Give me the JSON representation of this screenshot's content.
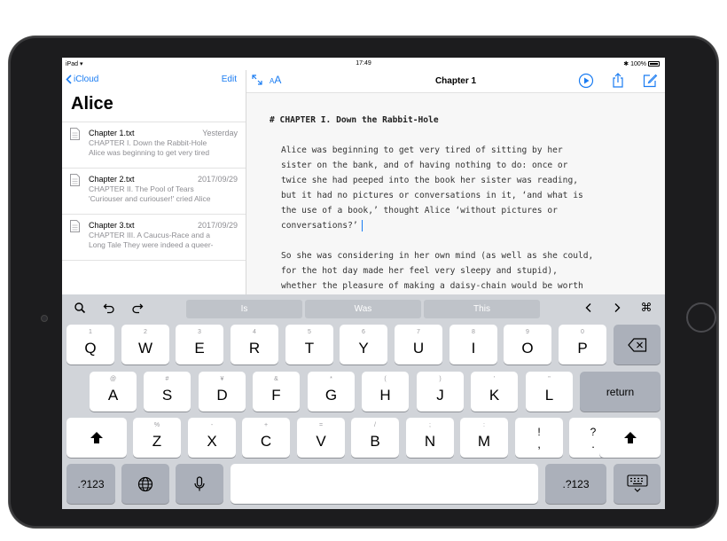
{
  "status_bar": {
    "device": "iPad",
    "time": "17:49",
    "battery": "100%"
  },
  "sidebar": {
    "back_label": "iCloud",
    "edit_label": "Edit",
    "title": "Alice",
    "documents": [
      {
        "name": "Chapter 1.txt",
        "date": "Yesterday",
        "preview_line1": "CHAPTER I. Down the Rabbit-Hole",
        "preview_line2": "Alice was beginning to get very tired"
      },
      {
        "name": "Chapter 2.txt",
        "date": "2017/09/29",
        "preview_line1": "CHAPTER II. The Pool of Tears",
        "preview_line2": "'Curiouser and curiouser!' cried Alice"
      },
      {
        "name": "Chapter 3.txt",
        "date": "2017/09/29",
        "preview_line1": "CHAPTER III. A Caucus-Race and a",
        "preview_line2": "Long Tale They were indeed a queer-"
      }
    ]
  },
  "editor": {
    "font_size_label_small": "A",
    "font_size_label_large": "A",
    "title": "Chapter 1",
    "heading": "# CHAPTER I. Down the Rabbit-Hole",
    "paragraph1": "Alice was beginning to get very tired of sitting by her\nsister on the bank, and of having nothing to do: once or\ntwice she had peeped into the book her sister was reading,\nbut it had no pictures or conversations in it, ‘and what is\nthe use of a book,’ thought Alice ‘without pictures or\nconversations?’",
    "paragraph2": "So she was considering in her own mind (as well as she could,\nfor the hot day made her feel very sleepy and stupid),\nwhether the pleasure of making a daisy-chain would be worth"
  },
  "keyboard": {
    "suggestions": [
      "Is",
      "Was",
      "This"
    ],
    "row1": [
      {
        "hint": "1",
        "label": "Q"
      },
      {
        "hint": "2",
        "label": "W"
      },
      {
        "hint": "3",
        "label": "E"
      },
      {
        "hint": "4",
        "label": "R"
      },
      {
        "hint": "5",
        "label": "T"
      },
      {
        "hint": "6",
        "label": "Y"
      },
      {
        "hint": "7",
        "label": "U"
      },
      {
        "hint": "8",
        "label": "I"
      },
      {
        "hint": "9",
        "label": "O"
      },
      {
        "hint": "0",
        "label": "P"
      }
    ],
    "row2": [
      {
        "hint": "@",
        "label": "A"
      },
      {
        "hint": "#",
        "label": "S"
      },
      {
        "hint": "¥",
        "label": "D"
      },
      {
        "hint": "&",
        "label": "F"
      },
      {
        "hint": "*",
        "label": "G"
      },
      {
        "hint": "(",
        "label": "H"
      },
      {
        "hint": ")",
        "label": "J"
      },
      {
        "hint": "'",
        "label": "K"
      },
      {
        "hint": "\"",
        "label": "L"
      }
    ],
    "return_label": "return",
    "row3": [
      {
        "hint": "%",
        "label": "Z"
      },
      {
        "hint": "-",
        "label": "X"
      },
      {
        "hint": "+",
        "label": "C"
      },
      {
        "hint": "=",
        "label": "V"
      },
      {
        "hint": "/",
        "label": "B"
      },
      {
        "hint": ";",
        "label": "N"
      },
      {
        "hint": ":",
        "label": "M"
      }
    ],
    "punct1_top": "!",
    "punct1_bottom": ",",
    "punct2_top": "?",
    "punct2_bottom": ".",
    "numbers_label": ".?123"
  }
}
